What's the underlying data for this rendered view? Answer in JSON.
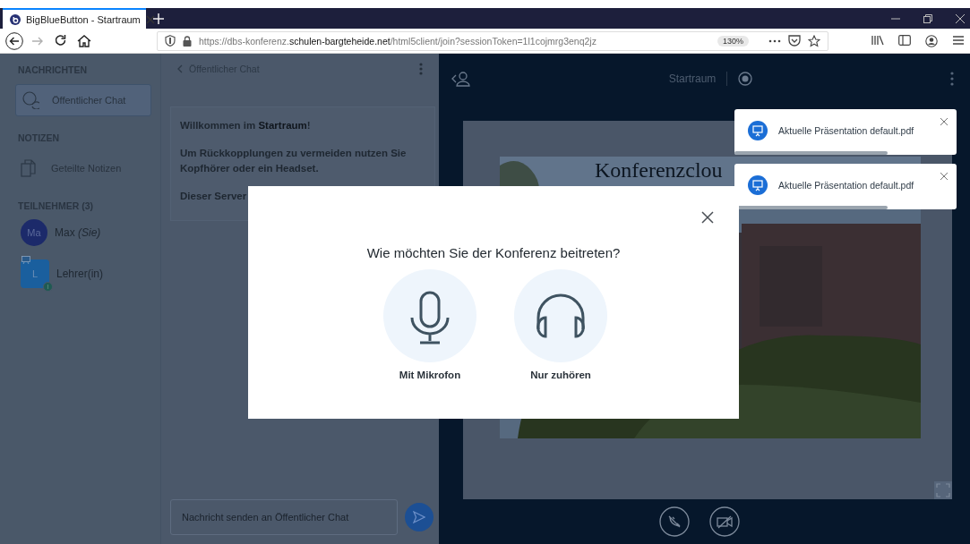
{
  "browser": {
    "tab": {
      "title": "BigBlueButton - Startraum"
    },
    "nav": [
      {
        "kind": "back",
        "disabled": false
      },
      {
        "kind": "forward",
        "disabled": true
      },
      {
        "kind": "reload",
        "disabled": false
      },
      {
        "kind": "home",
        "disabled": false
      }
    ],
    "url": {
      "prefix": "https://dbs-konferenz.",
      "domain": "schulen-bargteheide.net",
      "path": "/html5client/join?sessionToken=1l1cojmrg3enq2jz"
    },
    "zoom": "130%"
  },
  "sidebar": {
    "sections": [
      {
        "heading": "NACHRICHTEN",
        "items": [
          {
            "kind": "chat",
            "label": "Öffentlicher Chat",
            "selected": true
          }
        ]
      },
      {
        "heading": "NOTIZEN",
        "items": [
          {
            "kind": "notes",
            "label": "Geteilte Notizen",
            "selected": false
          }
        ]
      }
    ],
    "participants": {
      "heading": "TEILNEHMER (3)",
      "users": [
        {
          "kind": "round",
          "avatar": "Ma",
          "name": "Max *(Sie)*",
          "color": "#1c2a6a"
        },
        {
          "kind": "square",
          "avatar": "L",
          "name": "Lehrer(in)",
          "color": "#1a5f9e"
        }
      ]
    }
  },
  "chat": {
    "title": "Öffentlicher Chat",
    "messages": [
      "Willkommen im **Startraum**!",
      "Um Rückkopplungen zu vermeiden nutzen Sie Kopfhörer oder ein Headset.",
      "Dieser Server"
    ],
    "input": {
      "placeholder": "Nachricht senden an Öffentlicher Chat"
    }
  },
  "presentation": {
    "room_title": "Startraum",
    "slide": {
      "title": "Konferenzclou",
      "kind": "picture"
    },
    "controls": [
      {
        "kind": "audio-off"
      },
      {
        "kind": "video-off"
      }
    ]
  },
  "toasts": [
    {
      "text": "Aktuelle Präsentation default.pdf",
      "level": 0.69
    },
    {
      "text": "Aktuelle Präsentation default.pdf",
      "level": 0.69
    }
  ],
  "modal": {
    "title": "Wie möchten Sie der Konferenz beitreten?",
    "options": [
      {
        "kind": "microphone",
        "label": "Mit Mikrofon"
      },
      {
        "kind": "listen",
        "label": "Nur zuhören"
      }
    ]
  }
}
